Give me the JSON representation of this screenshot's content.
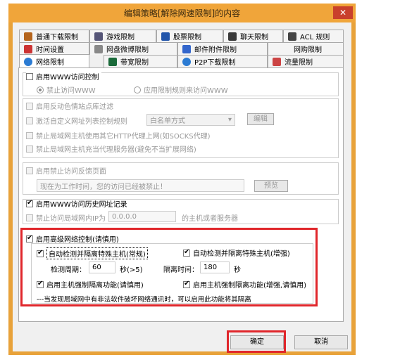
{
  "window": {
    "title": "编辑策略[解除网速限制]的内容",
    "close": "✕"
  },
  "tabs_row1": [
    {
      "label": "普通下载限制",
      "icon": "download-limit-icon",
      "color": "#b5651d"
    },
    {
      "label": "游戏限制",
      "icon": "game-icon",
      "color": "#555577"
    },
    {
      "label": "股票限制",
      "icon": "stock-icon",
      "color": "#2255aa"
    },
    {
      "label": "聊天限制",
      "icon": "chat-icon",
      "color": "#3a3a3a"
    },
    {
      "label": "ACL 规则",
      "icon": "acl-icon",
      "color": "#444"
    }
  ],
  "tabs_row2": [
    {
      "label": "时间设置",
      "icon": "clock-icon",
      "color": "#cc3333"
    },
    {
      "label": "网盘微博限制",
      "icon": "cloud-icon",
      "color": "#888"
    },
    {
      "label": "邮件附件限制",
      "icon": "mail-icon",
      "color": "#3366cc"
    },
    {
      "label": "网购限制",
      "icon": "shop-icon",
      "color": "#777"
    }
  ],
  "tabs_row3": [
    {
      "label": "网络限制",
      "icon": "network-icon",
      "color": "#2b7bd3"
    },
    {
      "label": "带宽限制",
      "icon": "bandwidth-icon",
      "color": "#1a6a3a"
    },
    {
      "label": "P2P下载限制",
      "icon": "p2p-icon",
      "color": "#2b7bd3"
    },
    {
      "label": "流量限制",
      "icon": "traffic-icon",
      "color": "#cc4444"
    }
  ],
  "www": {
    "enable": "启用WWW访问控制",
    "radio_forbid": "禁止访问WWW",
    "radio_app": "应用限制规则来访问WWW"
  },
  "filter": {
    "reverse": "启用反动色情站点库过滤",
    "custom": "激活自定义网址列表控制规则",
    "list_mode": "白名单方式",
    "edit": "编辑",
    "proxy_http": "禁止局域网主机使用其它HTTP代理上网(如SOCKS代理)",
    "proxy_server": "禁止局域网主机充当代理服务器(避免不当扩展网络)"
  },
  "feedback": {
    "enable": "启用禁止访问反馈页面",
    "message": "现在为工作时间，您的访问已经被禁止！",
    "preview": "预览"
  },
  "history": {
    "enable": "启用WWW访问历史网址记录",
    "forbid_ip": "禁止访问局域网内IP为",
    "ip": "0.0.0.0",
    "suffix": "的主机或者服务器"
  },
  "advanced": {
    "enable": "启用高级网络控制(请慎用)",
    "auto_normal": "自动检测并隔离特殊主机(常规)",
    "auto_strong": "自动检测并隔离特殊主机(增强)",
    "period_label": "检测周期：",
    "period_value": "60",
    "period_unit": "秒(>5)",
    "isolate_label": "隔离时间：",
    "isolate_value": "180",
    "isolate_unit": "秒",
    "force_isolate": "启用主机强制隔离功能(请慎用)",
    "force_isolate_strong": "启用主机强制隔离功能(增强,请慎用)",
    "note": "---当发现局域网中有非法软件破坏网络通讯时，可以启用此功能将其隔离"
  },
  "buttons": {
    "ok": "确定",
    "cancel": "取消"
  },
  "colors": {
    "highlight": "#e0262b",
    "titlebar": "#f0a53a"
  }
}
